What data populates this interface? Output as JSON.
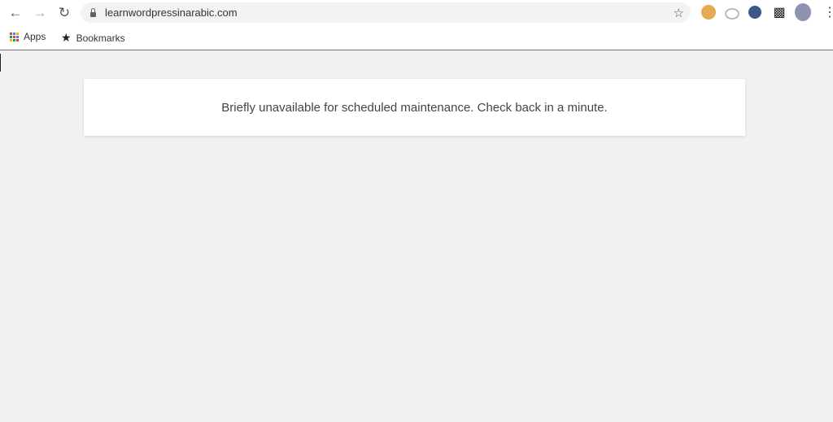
{
  "browser": {
    "url": "learnwordpressinarabic.com",
    "icons": [
      "back-arrow",
      "forward-arrow",
      "reload",
      "lock",
      "star",
      "cookie-extension",
      "cloud-extension",
      "cursor-extension",
      "puzzle-extensions",
      "profile-avatar",
      "more-menu"
    ]
  },
  "bookmarks": [
    {
      "label": "Apps",
      "icon": "apps-grid"
    },
    {
      "label": "Bookmarks",
      "icon": "star"
    }
  ],
  "page": {
    "message": "Briefly unavailable for scheduled maintenance. Check back in a minute."
  }
}
